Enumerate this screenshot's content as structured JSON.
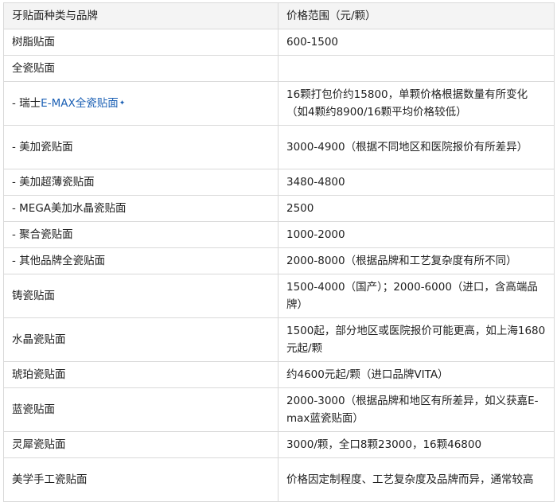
{
  "table": {
    "headers": [
      "牙贴面种类与品牌",
      "价格范围（元/颗）"
    ],
    "rows": [
      {
        "name": "树脂贴面",
        "price": "600-1500"
      },
      {
        "name": "全瓷贴面",
        "price": ""
      },
      {
        "name_prefix": "- 瑞士",
        "name_link": "E-MAX全瓷贴面",
        "marker": "✦",
        "price": "16颗打包价约15800，单颗价格根据数量有所变化（如4颗约8900/16颗平均价格较低）"
      },
      {
        "name": "- 美加瓷贴面",
        "price": "3000-4900（根据不同地区和医院报价有所差异）"
      },
      {
        "name": "- 美加超薄瓷贴面",
        "price": "3480-4800"
      },
      {
        "name": "- MEGA美加水晶瓷贴面",
        "price": "2500"
      },
      {
        "name": "- 聚合瓷贴面",
        "price": "1000-2000"
      },
      {
        "name": "- 其他品牌全瓷贴面",
        "price": "2000-8000（根据品牌和工艺复杂度有所不同）"
      },
      {
        "name": "铸瓷贴面",
        "price": "1500-4000（国产）；2000-6000（进口，含高端品牌）"
      },
      {
        "name": "水晶瓷贴面",
        "price": "1500起，部分地区或医院报价可能更高，如上海1680元起/颗"
      },
      {
        "name": "琥珀瓷贴面",
        "price": "约4600元起/颗（进口品牌VITA）"
      },
      {
        "name": "蓝瓷贴面",
        "price": "2000-3000（根据品牌和地区有所差异，如义获嘉E-max蓝瓷贴面）"
      },
      {
        "name": "灵犀瓷贴面",
        "price": "3000/颗，全口8颗23000，16颗46800"
      },
      {
        "name": "美学手工瓷贴面",
        "price": "价格因定制程度、工艺复杂度及品牌而异，通常较高"
      }
    ]
  }
}
